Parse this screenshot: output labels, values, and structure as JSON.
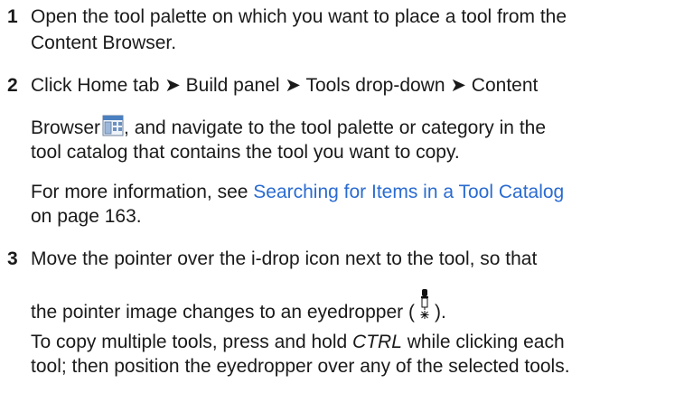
{
  "steps": {
    "s1": {
      "num": "1",
      "line1": "Open the tool palette on which you want to place a tool from the",
      "line2": "Content Browser."
    },
    "s2": {
      "num": "2",
      "line1": "Click Home tab ➤ Build panel ➤ Tools drop-down ➤ Content",
      "line2_pre": "Browser",
      "line2_post": ", and navigate to the tool palette or category in the",
      "line3": "tool catalog that contains the tool you want to copy.",
      "para_pre": "For more information, see ",
      "para_link": "Searching for Items in a Tool Catalog",
      "para_post": "on page 163.",
      "icon": "content-browser-icon"
    },
    "s3": {
      "num": "3",
      "line1": "Move the pointer over the i-drop icon next to the tool, so that",
      "line2_pre": "the pointer image changes to an eyedropper (",
      "line2_post": ").",
      "icon": "eyedropper-icon",
      "para_pre": "To copy multiple tools, press and hold ",
      "para_key": "CTRL",
      "para_mid": " while clicking each",
      "para_line2": "tool; then position the eyedropper over any of the selected tools."
    }
  },
  "colors": {
    "link": "#2a6bd1",
    "text": "#1a1a1a"
  }
}
